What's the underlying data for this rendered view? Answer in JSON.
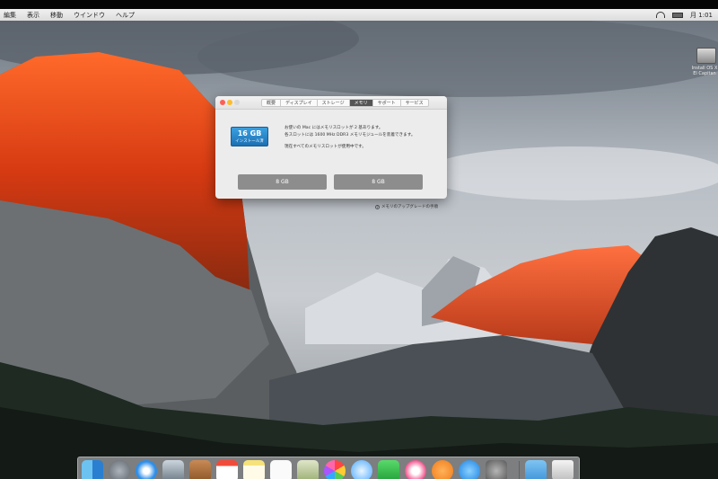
{
  "menubar": {
    "items": [
      "編集",
      "表示",
      "移動",
      "ウインドウ",
      "ヘルプ"
    ],
    "clock": "月 1:01"
  },
  "desktop": {
    "disk_label": "Install OS X El Capitan"
  },
  "window": {
    "tabs": [
      "概要",
      "ディスプレイ",
      "ストレージ",
      "メモリ",
      "サポート",
      "サービス"
    ],
    "active_tab": "メモリ",
    "memory": {
      "size": "16 GB",
      "installed": "インストール済"
    },
    "info_lines": [
      "お使いの Mac にはメモリスロットが 2 基あります。",
      "各スロットには 1600 MHz DDR3 メモリモジュールを装着できます。",
      "現在すべてのメモリスロットが使用中です。"
    ],
    "slots": [
      "8 GB",
      "8 GB"
    ],
    "upgrade_link": "メモリのアップグレードの手順"
  },
  "dock": {
    "apps": [
      "Finder",
      "Launchpad",
      "Safari",
      "Photo Booth",
      "連絡先",
      "カレンダー",
      "メモ",
      "リマインダー",
      "プレビュー",
      "写真",
      "メッセージ",
      "FaceTime",
      "iTunes",
      "iBooks",
      "App Store",
      "システム環境設定",
      "ダウンロード",
      "ゴミ箱"
    ]
  }
}
